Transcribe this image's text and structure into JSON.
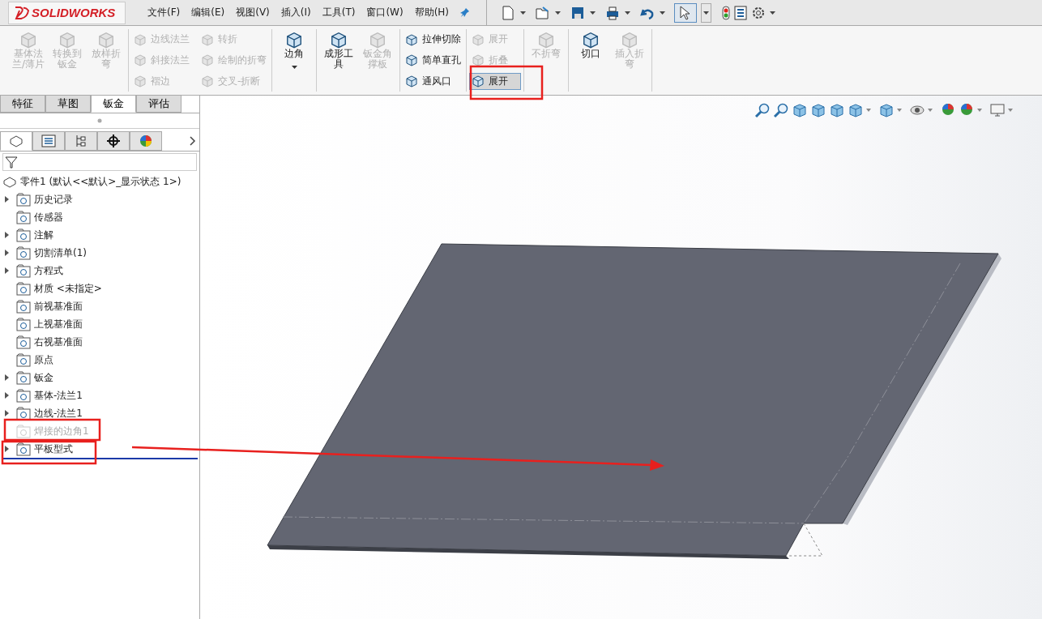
{
  "app": {
    "logo": "SOLIDWORKS"
  },
  "menu": [
    "文件(F)",
    "编辑(E)",
    "视图(V)",
    "插入(I)",
    "工具(T)",
    "窗口(W)",
    "帮助(H)"
  ],
  "ribbon": {
    "groups": [
      {
        "kind": "large",
        "items": [
          {
            "label": "基体法兰/薄片",
            "disabled": true
          },
          {
            "label": "转换到钣金",
            "disabled": true
          },
          {
            "label": "放样折弯",
            "disabled": true
          }
        ]
      },
      {
        "kind": "columns",
        "items": [
          {
            "label": "边线法兰",
            "disabled": true
          },
          {
            "label": "斜接法兰",
            "disabled": true
          },
          {
            "label": "褶边",
            "disabled": true
          },
          {
            "label": "转折",
            "disabled": true
          },
          {
            "label": "绘制的折弯",
            "disabled": true
          },
          {
            "label": "交叉-折断",
            "disabled": true
          }
        ]
      },
      {
        "kind": "large",
        "items": [
          {
            "label": "边角",
            "disabled": false,
            "dropdown": true
          }
        ]
      },
      {
        "kind": "large",
        "items": [
          {
            "label": "成形工具",
            "disabled": false
          },
          {
            "label": "钣金角撑板",
            "disabled": true
          }
        ]
      },
      {
        "kind": "small",
        "items": [
          {
            "label": "拉伸切除",
            "disabled": false
          },
          {
            "label": "简单直孔",
            "disabled": false
          },
          {
            "label": "通风口",
            "disabled": false
          }
        ]
      },
      {
        "kind": "small",
        "items": [
          {
            "label": "展开",
            "disabled": true,
            "selected": false
          },
          {
            "label": "折叠",
            "disabled": true,
            "selected": false
          },
          {
            "label": "展开",
            "disabled": false,
            "selected": true
          }
        ]
      },
      {
        "kind": "large",
        "items": [
          {
            "label": "不折弯",
            "disabled": true
          }
        ]
      },
      {
        "kind": "large",
        "items": [
          {
            "label": "切口",
            "disabled": false
          },
          {
            "label": "插入折弯",
            "disabled": true
          }
        ]
      }
    ]
  },
  "command_tabs": [
    {
      "label": "特征",
      "selected": false
    },
    {
      "label": "草图",
      "selected": false
    },
    {
      "label": "钣金",
      "selected": true
    },
    {
      "label": "评估",
      "selected": false
    }
  ],
  "panel_tabs": [
    {
      "selected": true
    },
    {
      "selected": false
    },
    {
      "selected": false
    },
    {
      "selected": false
    },
    {
      "selected": false
    }
  ],
  "tree": {
    "root": "零件1  (默认<<默认>_显示状态 1>)",
    "items": [
      {
        "label": "历史记录",
        "expandable": true,
        "disabled": false
      },
      {
        "label": "传感器",
        "expandable": false,
        "disabled": false
      },
      {
        "label": "注解",
        "expandable": true,
        "disabled": false
      },
      {
        "label": "切割清单(1)",
        "expandable": true,
        "disabled": false
      },
      {
        "label": "方程式",
        "expandable": true,
        "disabled": false
      },
      {
        "label": "材质 <未指定>",
        "expandable": false,
        "disabled": false
      },
      {
        "label": "前视基准面",
        "expandable": false,
        "disabled": false
      },
      {
        "label": "上视基准面",
        "expandable": false,
        "disabled": false
      },
      {
        "label": "右视基准面",
        "expandable": false,
        "disabled": false
      },
      {
        "label": "原点",
        "expandable": false,
        "disabled": false
      },
      {
        "label": "钣金",
        "expandable": true,
        "disabled": false
      },
      {
        "label": "基体-法兰1",
        "expandable": true,
        "disabled": false
      },
      {
        "label": "边线-法兰1",
        "expandable": true,
        "disabled": false
      },
      {
        "label": "焊接的边角1",
        "expandable": false,
        "disabled": true
      },
      {
        "label": "平板型式",
        "expandable": true,
        "disabled": false
      }
    ]
  }
}
